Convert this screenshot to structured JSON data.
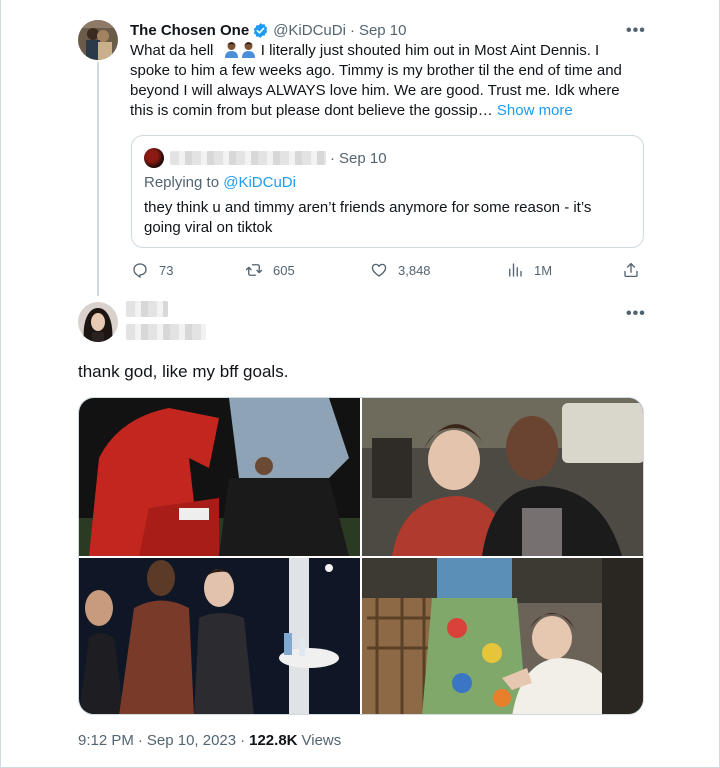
{
  "tweet": {
    "author_name": "The Chosen One",
    "author_handle": "@KiDCuDi",
    "dot": "·",
    "date": "Sep 10",
    "more_icon": "more-horizontal-icon",
    "body_lines": [
      [
        "What da hell",
        " I literally just shouted him out in Most Aint Dennis.  I"
      ],
      "spoke to him a few weeks ago.  Timmy is my brother til the end of time and",
      "beyond I will always ALWAYS love him.  We are good.  Trust me.  Idk where",
      "this is comin from but please dont believe the gossip…"
    ],
    "show_more": "Show more",
    "quote": {
      "date": "Sep 10",
      "replying_prefix": "Replying to",
      "replying_handle": "@KiDCuDi",
      "text_lines": [
        "they think u and timmy aren’t friends anymore for some reason - it’s",
        "going viral on tiktok"
      ]
    },
    "actions": {
      "replies": "73",
      "retweets": "605",
      "likes": "3,848",
      "views": "1M"
    }
  },
  "reply": {
    "text": "thank god, like my bff goals.",
    "timestamp_time": "9:12 PM",
    "timestamp_date": "Sep 10, 2023",
    "views_count": "122.8K",
    "views_label": "Views"
  },
  "colors": {
    "accent": "#1d9bf0",
    "muted": "#536471",
    "text": "#0f1419",
    "border": "#cfd9de"
  }
}
